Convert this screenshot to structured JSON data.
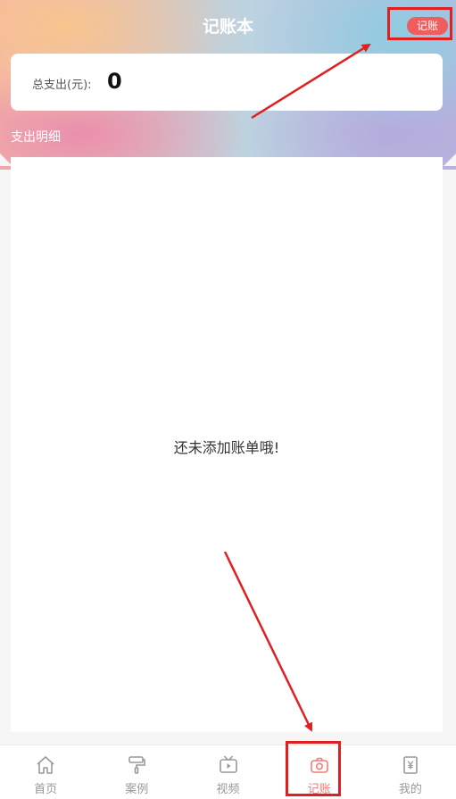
{
  "header": {
    "title": "记账本",
    "add_button_label": "记账"
  },
  "summary": {
    "label": "总支出(元):",
    "value": "0"
  },
  "section": {
    "title": "支出明细"
  },
  "list": {
    "empty_text": "还未添加账单哦!"
  },
  "tabbar": {
    "items": [
      {
        "label": "首页",
        "icon": "home-icon"
      },
      {
        "label": "案例",
        "icon": "paint-roller-icon"
      },
      {
        "label": "视频",
        "icon": "tv-icon"
      },
      {
        "label": "记账",
        "icon": "camera-icon",
        "active": true
      },
      {
        "label": "我的",
        "icon": "yen-document-icon"
      }
    ],
    "active_color": "#f07c7c",
    "inactive_color": "#999999"
  },
  "colors": {
    "accent_red": "#ef5d5d",
    "annotation_red": "#e02020"
  }
}
